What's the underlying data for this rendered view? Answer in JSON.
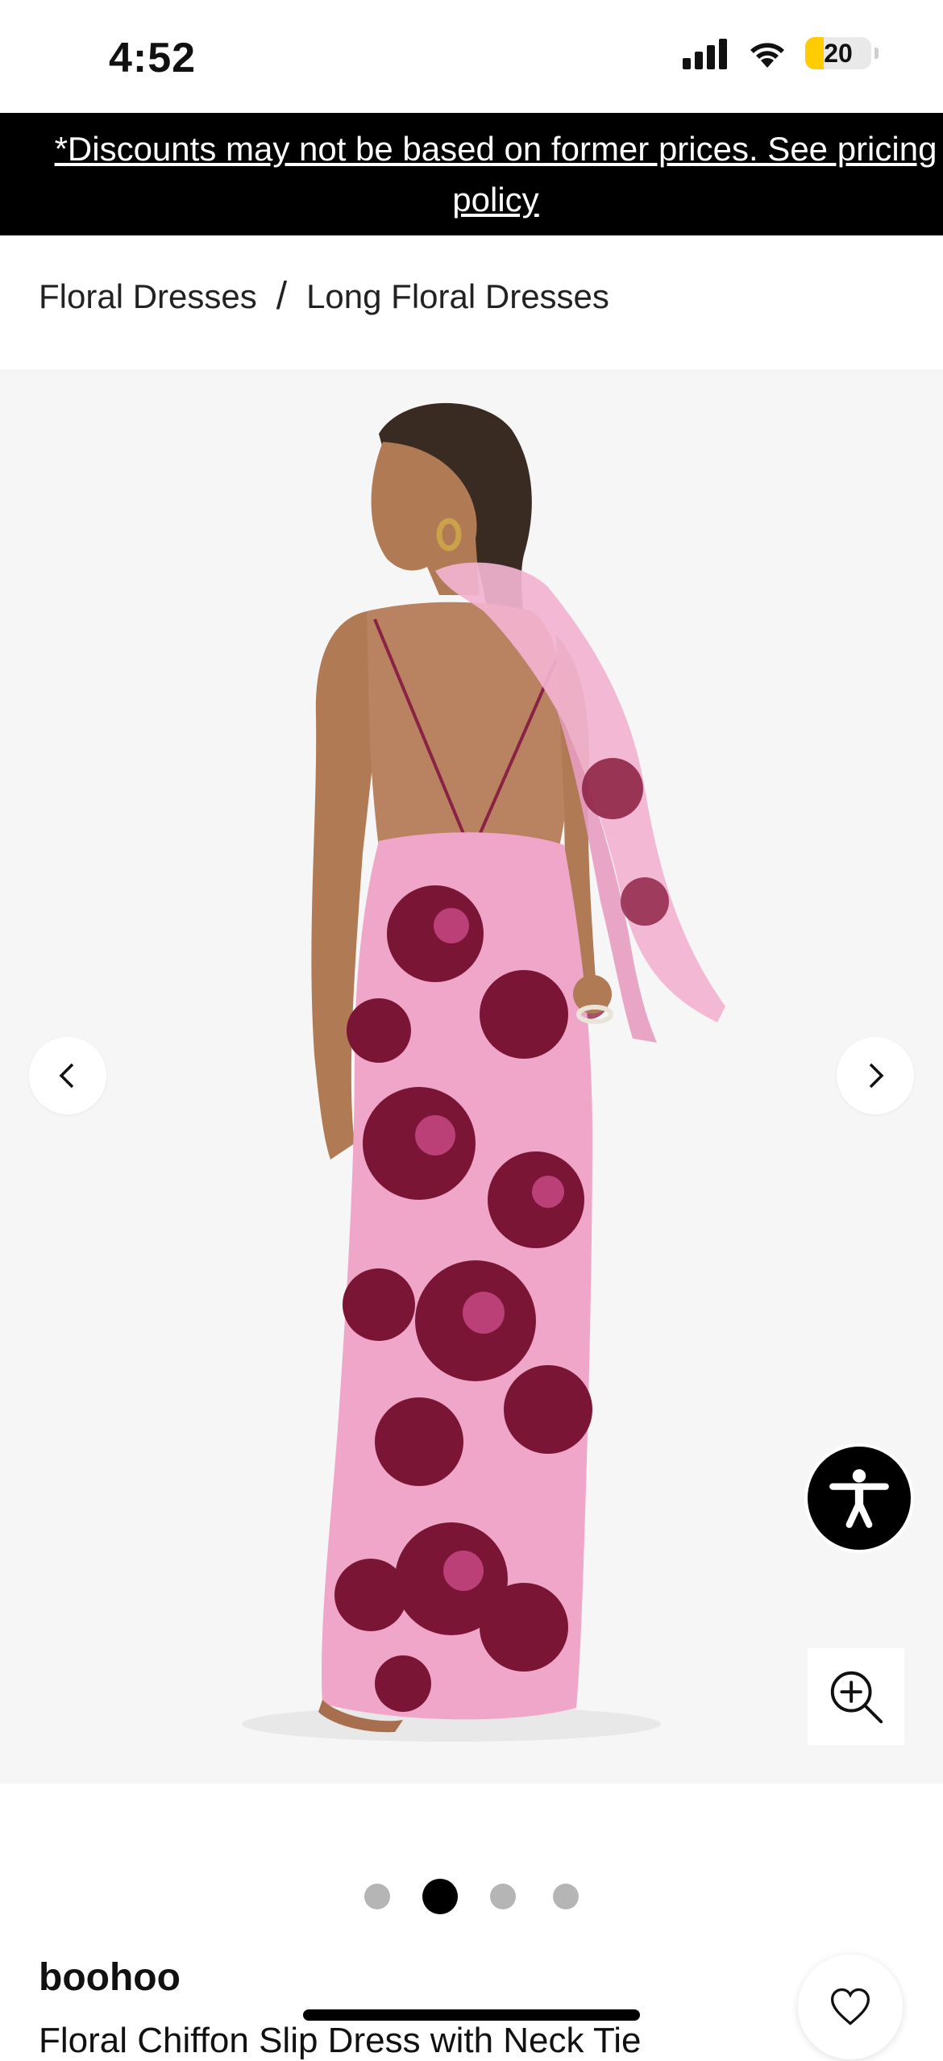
{
  "status_bar": {
    "time": "4:52",
    "battery": "20"
  },
  "promo": {
    "text": "*Discounts may not be based on former prices. See pricing policy"
  },
  "breadcrumb": {
    "items": [
      "Floral Dresses",
      "Long Floral Dresses"
    ],
    "separator": "/"
  },
  "gallery": {
    "dot_count": 4,
    "active_dot": 2,
    "icons": {
      "prev": "chevron-left-icon",
      "next": "chevron-right-icon",
      "accessibility": "accessibility-icon",
      "zoom": "zoom-in-icon"
    }
  },
  "product": {
    "brand": "boohoo",
    "title": "Floral Chiffon Slip Dress with Neck Tie"
  },
  "wishlist": {
    "icon": "heart-icon"
  },
  "colors": {
    "banner_bg": "#000000",
    "dress_pink": "#f0a6c8",
    "flower_dark": "#7a1535",
    "gallery_bg": "#f6f6f6"
  }
}
